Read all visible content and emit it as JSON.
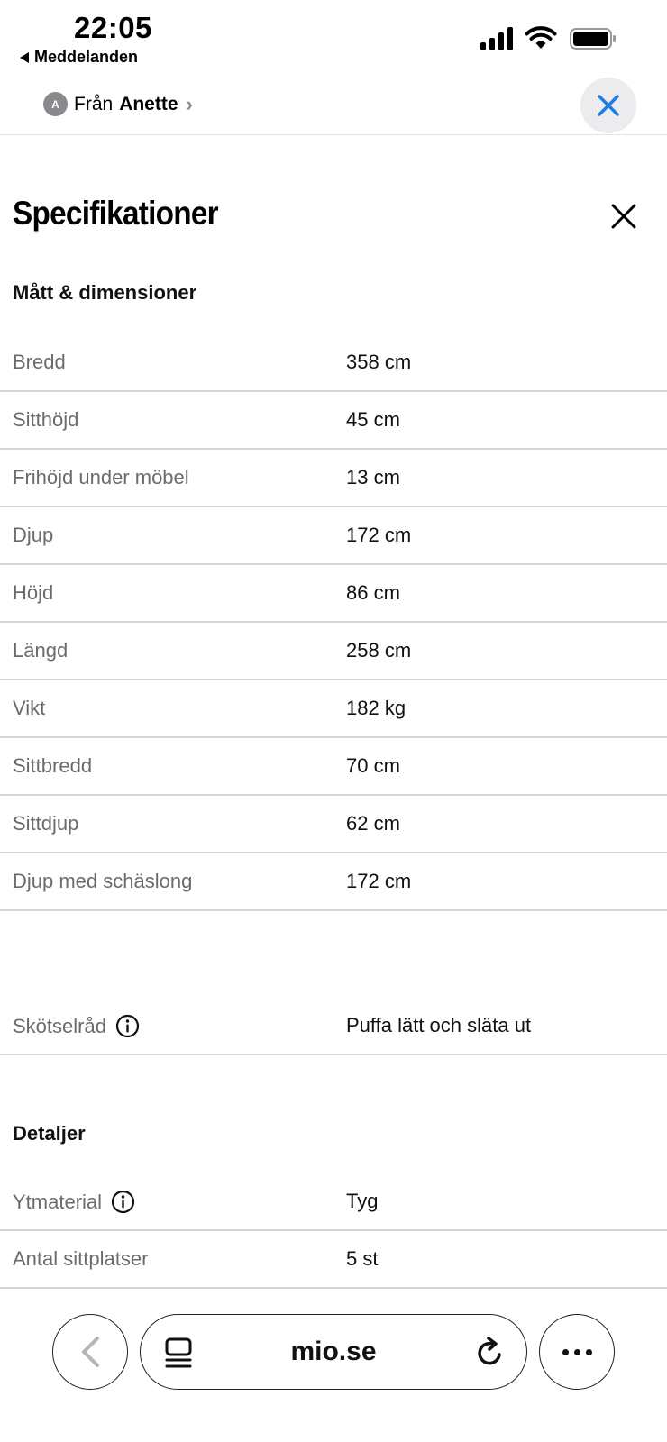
{
  "status_bar": {
    "time": "22:05",
    "back_app": "Meddelanden"
  },
  "header": {
    "avatar_initial": "A",
    "from_prefix": "Från",
    "from_name": "Anette"
  },
  "spec": {
    "title": "Specifikationer",
    "dimensions_heading": "Mått & dimensioner",
    "dimensions": [
      {
        "label": "Bredd",
        "value": "358 cm"
      },
      {
        "label": "Sitthöjd",
        "value": "45 cm"
      },
      {
        "label": "Frihöjd under möbel",
        "value": "13 cm"
      },
      {
        "label": "Djup",
        "value": "172 cm"
      },
      {
        "label": "Höjd",
        "value": "86 cm"
      },
      {
        "label": "Längd",
        "value": "258 cm"
      },
      {
        "label": "Vikt",
        "value": "182 kg"
      },
      {
        "label": "Sittbredd",
        "value": "70 cm"
      },
      {
        "label": "Sittdjup",
        "value": "62 cm"
      },
      {
        "label": "Djup med schäslong",
        "value": "172 cm"
      }
    ],
    "care": {
      "label": "Skötselråd",
      "value": "Puffa lätt och släta ut",
      "icon": "info-icon"
    },
    "details_heading": "Detaljer",
    "details": [
      {
        "label": "Ytmaterial",
        "value": "Tyg",
        "icon": "info-icon"
      },
      {
        "label": "Antal sittplatser",
        "value": "5 st"
      }
    ]
  },
  "browser": {
    "url": "mio.se"
  },
  "colors": {
    "accent_blue": "#1a7ee6",
    "label_gray": "#6b6b6b",
    "divider": "#d6d6d6"
  }
}
